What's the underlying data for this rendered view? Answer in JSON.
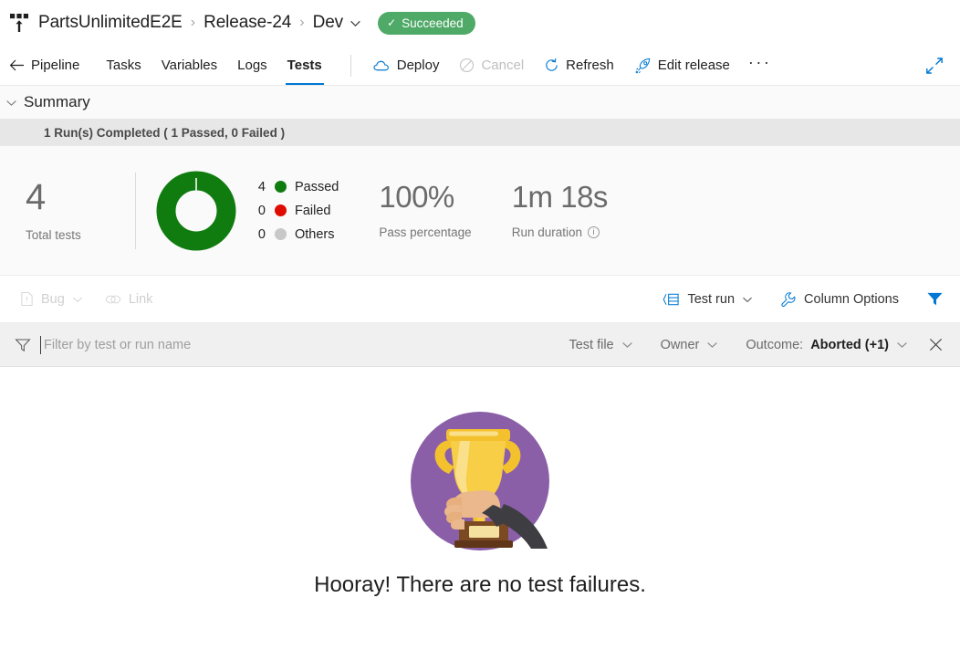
{
  "breadcrumb": {
    "icon": "release-pipeline-icon",
    "items": [
      {
        "label": "PartsUnlimitedE2E"
      },
      {
        "label": "Release-24"
      },
      {
        "label": "Dev"
      }
    ],
    "separator": "›",
    "status": {
      "label": "Succeeded",
      "color": "#4fa967",
      "check": "✓"
    }
  },
  "toolbar": {
    "back_label": "Pipeline",
    "tabs": [
      {
        "label": "Tasks",
        "selected": false
      },
      {
        "label": "Variables",
        "selected": false
      },
      {
        "label": "Logs",
        "selected": false
      },
      {
        "label": "Tests",
        "selected": true
      }
    ],
    "commands": [
      {
        "label": "Deploy",
        "icon": "cloud-icon",
        "disabled": false
      },
      {
        "label": "Cancel",
        "icon": "cancel-circle-icon",
        "disabled": true
      },
      {
        "label": "Refresh",
        "icon": "refresh-icon",
        "disabled": false
      },
      {
        "label": "Edit release",
        "icon": "rocket-icon",
        "disabled": false
      }
    ],
    "more_label": "···",
    "expand_icon": "expand-diagonal-icon",
    "accent": "#0078d4"
  },
  "summary": {
    "title": "Summary",
    "collapse_icon": "chevron-down-icon",
    "run_banner": "1 Run(s) Completed ( 1 Passed, 0 Failed )",
    "total": {
      "value": "4",
      "label": "Total tests"
    },
    "legend": [
      {
        "count": "4",
        "label": "Passed",
        "color": "#107c10"
      },
      {
        "count": "0",
        "label": "Failed",
        "color": "#e00b00"
      },
      {
        "count": "0",
        "label": "Others",
        "color": "#c8c8c8"
      }
    ],
    "pass_percentage": {
      "value": "100%",
      "label": "Pass percentage"
    },
    "run_duration": {
      "value": "1m 18s",
      "label": "Run duration",
      "info_icon": "info-icon",
      "info_glyph": "i"
    },
    "donut": {
      "passed_pct": 100,
      "color": "#107c10"
    }
  },
  "actions": {
    "bug": {
      "label": "Bug",
      "icon": "bug-file-icon",
      "chevron": "chevron-down-icon",
      "disabled": true
    },
    "link": {
      "label": "Link",
      "icon": "link-icon",
      "disabled": true
    },
    "test_run": {
      "label": "Test run",
      "icon": "group-by-icon",
      "chevron": "chevron-down-icon"
    },
    "column_options": {
      "label": "Column Options",
      "icon": "wrench-icon"
    },
    "filter_toggle": {
      "icon": "filter-funnel-icon",
      "color": "#0078d4"
    }
  },
  "filter": {
    "funnel_icon": "filter-funnel-icon",
    "placeholder": "Filter by test or run name",
    "value": "",
    "pills": [
      {
        "label": "Test file",
        "value": "",
        "chevron": "chevron-down-icon"
      },
      {
        "label": "Owner",
        "value": "",
        "chevron": "chevron-down-icon"
      },
      {
        "label": "Outcome:",
        "value": "Aborted (+1)",
        "chevron": "chevron-down-icon"
      }
    ],
    "close_icon": "close-icon"
  },
  "empty_state": {
    "image": "trophy-in-hand-illustration",
    "message": "Hooray! There are no test failures.",
    "circle_color": "#8a5fa8",
    "trophy_color": "#f7ce46"
  }
}
